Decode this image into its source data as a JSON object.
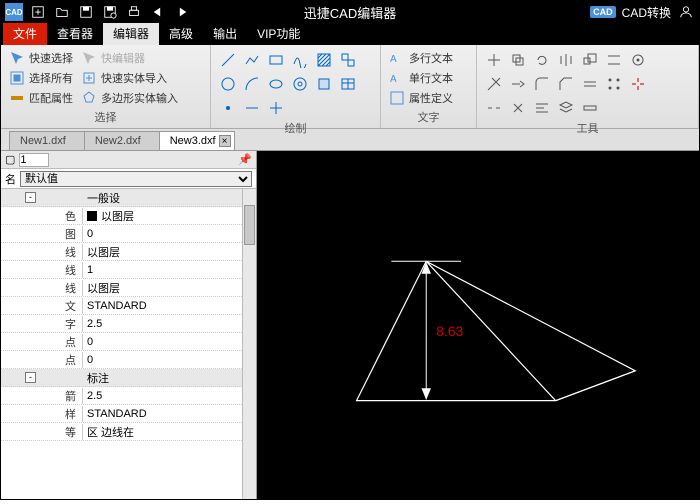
{
  "app": {
    "title": "迅捷CAD编辑器",
    "cadBadge": "CAD",
    "convert": "CAD转换"
  },
  "menu": {
    "file": "文件",
    "viewer": "查看器",
    "editor": "编辑器",
    "advanced": "高级",
    "output": "输出",
    "vip": "VIP功能"
  },
  "ribbon": {
    "select": {
      "label": "选择",
      "quick": "快速选择",
      "quickEdit": "快编辑器",
      "selectAll": "选择所有",
      "entityIns": "快速实体导入",
      "matchProp": "匹配属性",
      "polyIns": "多边形实体输入"
    },
    "draw": {
      "label": "绘制"
    },
    "text": {
      "label": "文字",
      "multi": "多行文本",
      "single": "单行文本",
      "attr": "属性定义"
    },
    "tools": {
      "label": "工具"
    }
  },
  "tabs": {
    "t1": "New1.dxf",
    "t2": "New2.dxf",
    "t3": "New3.dxf"
  },
  "side": {
    "tabLabel": "1",
    "nameLabel": "名",
    "default": "默认值",
    "groups": {
      "general": "一般设",
      "dim": "标注"
    },
    "rows": {
      "color": {
        "k": "色",
        "v": "以图层"
      },
      "layer": {
        "k": "图",
        "v": "0"
      },
      "lt": {
        "k": "线",
        "v": "以图层"
      },
      "lw": {
        "k": "线",
        "v": "1"
      },
      "lts": {
        "k": "线",
        "v": "以图层"
      },
      "ts": {
        "k": "文",
        "v": "STANDARD"
      },
      "th": {
        "k": "字",
        "v": "2.5"
      },
      "ps": {
        "k": "点",
        "v": "0"
      },
      "pz": {
        "k": "点",
        "v": "0"
      },
      "arr": {
        "k": "箭",
        "v": "2.5"
      },
      "sty": {
        "k": "样",
        "v": "STANDARD"
      },
      "ext": {
        "k": "等",
        "v": "区 边线在"
      }
    }
  },
  "canvas": {
    "dim": "8.63"
  }
}
